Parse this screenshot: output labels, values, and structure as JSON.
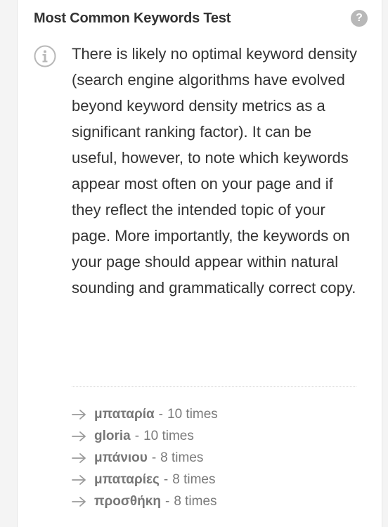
{
  "header": {
    "title": "Most Common Keywords Test",
    "help_glyph": "?"
  },
  "description": "There is likely no optimal keyword density (search engine algorithms have evolved beyond keyword density metrics as a significant ranking factor). It can be useful, however, to note which keywords appear most often on your page and if they reflect the intended topic of your page. More importantly, the keywords on your page should appear within natural sounding and grammatically correct copy.",
  "keywords": [
    {
      "word": "μπαταρία",
      "sep": "-",
      "count": "10 times"
    },
    {
      "word": "gloria",
      "sep": "-",
      "count": "10 times"
    },
    {
      "word": "μπάνιου",
      "sep": "-",
      "count": "8 times"
    },
    {
      "word": "μπαταρίες",
      "sep": "-",
      "count": "8 times"
    },
    {
      "word": "προσθήκη",
      "sep": "-",
      "count": "8 times"
    }
  ],
  "icons": {
    "info": "info-circle-icon",
    "help": "question-circle-icon",
    "bullet": "arrow-right-icon"
  },
  "colors": {
    "icon_gray": "#b8b8b8",
    "text": "#333333",
    "muted": "#7a7a7a"
  }
}
